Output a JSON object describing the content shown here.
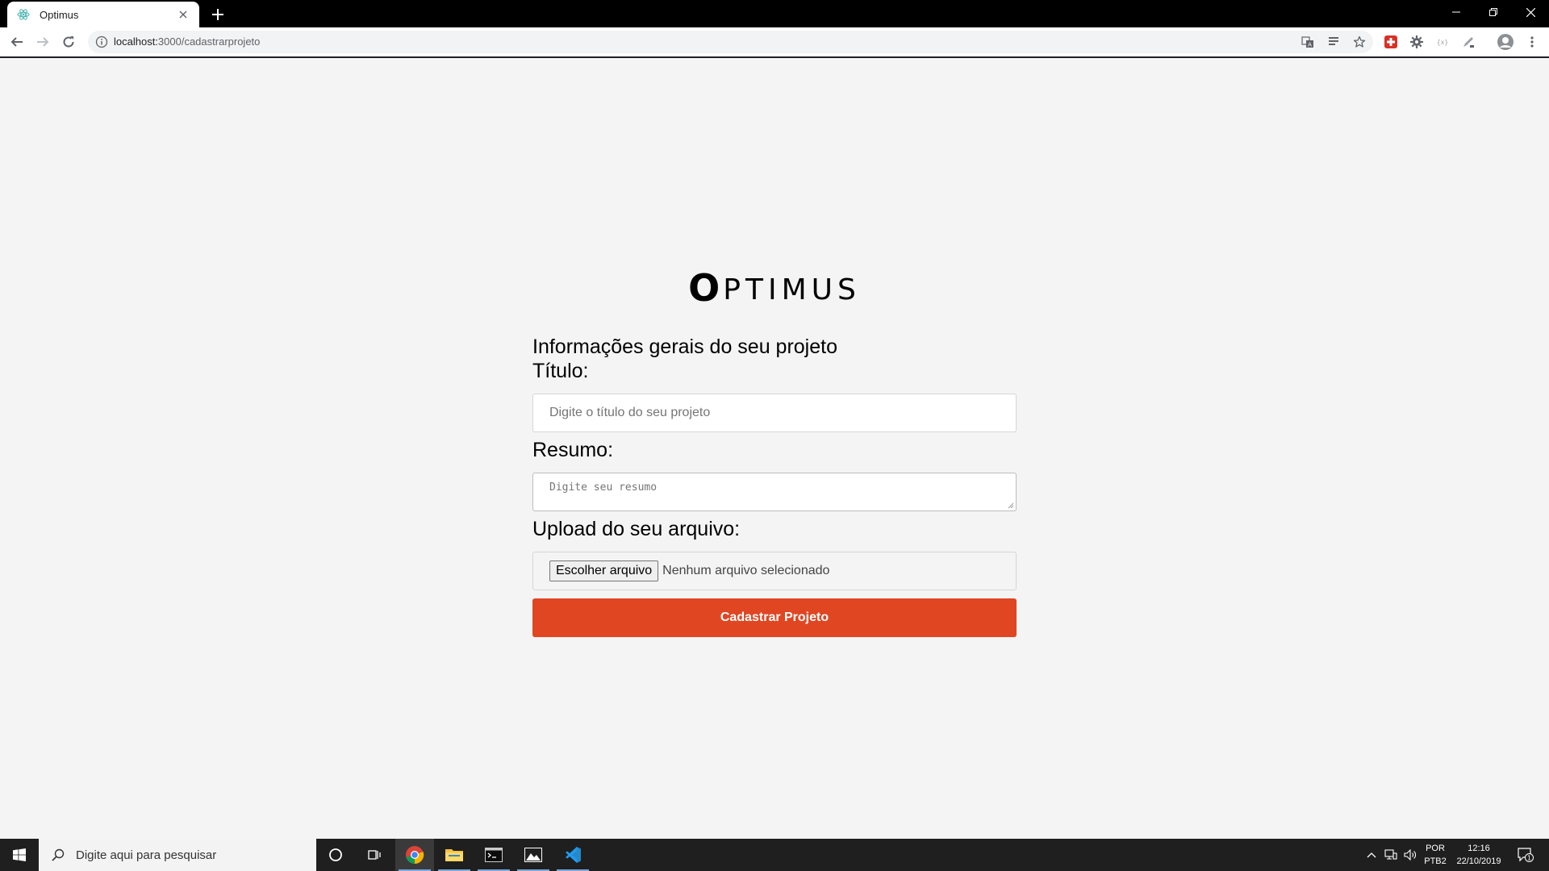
{
  "browser": {
    "tab_title": "Optimus",
    "url_host": "localhost:",
    "url_path": "3000/cadastrarprojeto"
  },
  "page": {
    "logo_first": "O",
    "logo_rest": "PTIMUS",
    "heading": "Informações gerais do seu projeto",
    "title_label": "Título:",
    "title_placeholder": "Digite o título do seu projeto",
    "summary_label": "Resumo:",
    "summary_placeholder": "Digite seu resumo",
    "upload_label": "Upload do seu arquivo:",
    "file_button": "Escolher arquivo",
    "file_status": "Nenhum arquivo selecionado",
    "submit_label": "Cadastrar Projeto",
    "accent_color": "#e04622"
  },
  "taskbar": {
    "search_placeholder": "Digite aqui para pesquisar",
    "lang_top": "POR",
    "lang_bottom": "PTB2",
    "time": "12:16",
    "date": "22/10/2019",
    "notification_count": "1"
  }
}
